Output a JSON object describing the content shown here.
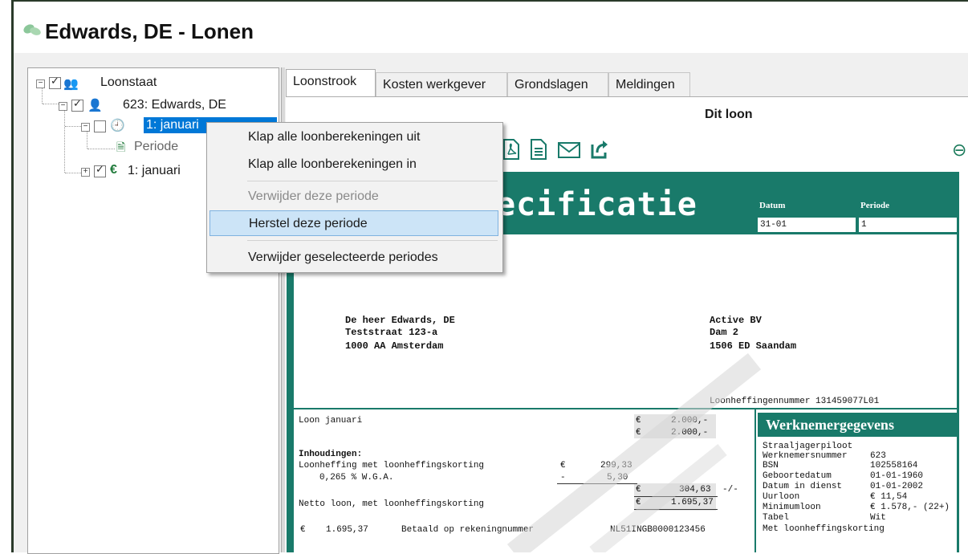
{
  "window": {
    "title": "Edwards, DE - Lonen"
  },
  "tree": {
    "root_label": "Loonstaat",
    "employee_label": "623: Edwards, DE",
    "period_selected_label": "1: januari",
    "period_label": "Periode",
    "period_euro_label": "1: januari"
  },
  "tabs": [
    {
      "label": "Loonstrook"
    },
    {
      "label": "Kosten werkgever"
    },
    {
      "label": "Grondslagen"
    },
    {
      "label": "Meldingen"
    }
  ],
  "panel_title": "Dit loon",
  "context_menu": {
    "items": [
      {
        "label": "Klap alle loonberekeningen uit",
        "enabled": true
      },
      {
        "label": "Klap alle loonberekeningen in",
        "enabled": true
      },
      {
        "label": "Verwijder deze periode",
        "enabled": false
      },
      {
        "label": "Herstel deze periode",
        "enabled": true,
        "highlighted": true
      },
      {
        "label": "Verwijder geselecteerde periodes",
        "enabled": true
      }
    ]
  },
  "payslip": {
    "title_visible": "ecificatie",
    "datum_label": "Datum",
    "datum_value": "31-01",
    "periode_label": "Periode",
    "periode_value": "1",
    "employee": {
      "line1": "De heer Edwards, DE",
      "line2": "Teststraat 123-a",
      "line3": "1000 AA Amsterdam"
    },
    "employer": {
      "line1": "Active BV",
      "line2": "Dam 2",
      "line3": "1506 ED Saandam"
    },
    "loonheffingennummer": "Loonheffingennummer 131459077L01",
    "lines": {
      "loon_label": "Loon januari",
      "loon_val1": "2.000,-",
      "loon_val2": "2.000,-",
      "inhoudingen_label": "Inhoudingen:",
      "loonheffing_label": "Loonheffing met loonheffingskorting",
      "loonheffing_val": "299,33",
      "wga_label": "0,265 % W.G.A.",
      "wga_val": "5,30",
      "subtotal_val": "304,63",
      "subtotal_suffix": "-/-",
      "netto_label": "Netto loon, met loonheffingskorting",
      "netto_val": "1.695,37",
      "paid_amount": "1.695,37",
      "paid_label": "Betaald op rekeningnummer",
      "iban": "NL51INGB0000123456",
      "euro": "€",
      "minus": "-"
    },
    "werknemer": {
      "header": "Werknemergegevens",
      "function": "Straaljagerpiloot",
      "rows": [
        {
          "label": "Werknemersnummer",
          "value": "623"
        },
        {
          "label": "BSN",
          "value": "102558164"
        },
        {
          "label": "Geboortedatum",
          "value": "01-01-1960"
        },
        {
          "label": "Datum in dienst",
          "value": "01-01-2002"
        },
        {
          "label": "Uurloon",
          "value": "€ 11,54"
        },
        {
          "label": "Minimumloon",
          "value": "€ 1.578,- (22+)"
        },
        {
          "label": "Tabel",
          "value": "Wit"
        }
      ],
      "korting": "Met loonheffingskorting"
    }
  },
  "colors": {
    "teal": "#197a6a",
    "selection": "#0078d7",
    "menu_highlight": "#cce4f7"
  },
  "icons": {
    "app": "leaf-icon",
    "toolbar": [
      "pdf-icon",
      "document-icon",
      "mail-icon",
      "share-icon"
    ],
    "zoom": "zoom-out-icon"
  }
}
